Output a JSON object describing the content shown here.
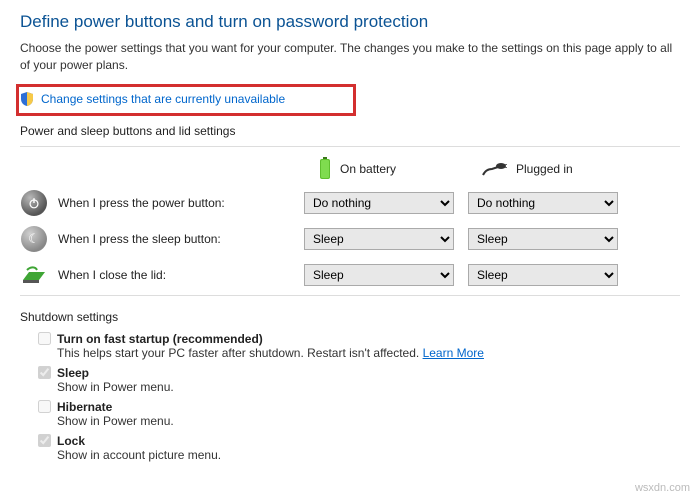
{
  "heading": "Define power buttons and turn on password protection",
  "subtext": "Choose the power settings that you want for your computer. The changes you make to the settings on this page apply to all of your power plans.",
  "changeLink": "Change settings that are currently unavailable",
  "sectionButtons": "Power and sleep buttons and lid settings",
  "headers": {
    "battery": "On battery",
    "plugged": "Plugged in"
  },
  "rows": [
    {
      "label": "When I press the power button:",
      "battery": "Do nothing",
      "plugged": "Do nothing"
    },
    {
      "label": "When I press the sleep button:",
      "battery": "Sleep",
      "plugged": "Sleep"
    },
    {
      "label": "When I close the lid:",
      "battery": "Sleep",
      "plugged": "Sleep"
    }
  ],
  "sectionShutdown": "Shutdown settings",
  "shutdown": {
    "fast": {
      "label": "Turn on fast startup (recommended)",
      "desc": "This helps start your PC faster after shutdown. Restart isn't affected. ",
      "learn": "Learn More",
      "checked": false
    },
    "sleep": {
      "label": "Sleep",
      "desc": "Show in Power menu.",
      "checked": true
    },
    "hibernate": {
      "label": "Hibernate",
      "desc": "Show in Power menu.",
      "checked": false
    },
    "lock": {
      "label": "Lock",
      "desc": "Show in account picture menu.",
      "checked": true
    }
  },
  "watermark": "wsxdn.com"
}
